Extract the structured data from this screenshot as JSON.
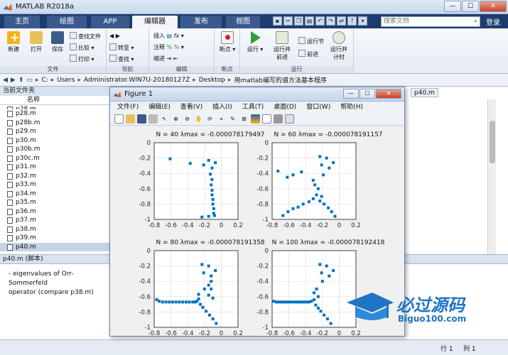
{
  "app": {
    "title": "MATLAB R2018a"
  },
  "window_buttons": {
    "minimize": "—",
    "maximize": "☐",
    "close": "✕"
  },
  "tabs": [
    {
      "label": "主页"
    },
    {
      "label": "绘图"
    },
    {
      "label": "APP"
    },
    {
      "label": "编辑器"
    },
    {
      "label": "发布"
    },
    {
      "label": "视图"
    }
  ],
  "search": {
    "placeholder": "搜索文档"
  },
  "login": "登录",
  "ribbon": {
    "file": {
      "new": "新建",
      "open": "打开",
      "save": "保存",
      "find_file": "查找文件",
      "compare": "比较",
      "print": "打印",
      "group": "文件"
    },
    "nav": {
      "goto": "转至",
      "find": "查找",
      "group": "导航"
    },
    "edit": {
      "insert": "插入",
      "comment": "注释",
      "indent": "缩进",
      "group": "编辑"
    },
    "breakpoints": {
      "label": "断点",
      "group": "断点"
    },
    "run": {
      "run": "运行",
      "run_advance": "运行并\n前进",
      "run_section": "运行节",
      "advance": "前进",
      "run_time": "运行并\n计时",
      "group": "运行"
    }
  },
  "address": [
    "C:",
    "Users",
    "Administrator.WIN7U-20180127Z",
    "Desktop",
    "用matlab编写的谱方法基本程序"
  ],
  "folder": {
    "title": "当前文件夹",
    "column": "名称",
    "files": [
      "p28.m",
      "p28b.m",
      "p29.m",
      "p30.m",
      "p30b.m",
      "p30c.m",
      "p31.m",
      "p32.m",
      "p33.m",
      "p34.m",
      "p35.m",
      "p36.m",
      "p37.m",
      "p38.m",
      "p39.m",
      "p40.m"
    ],
    "selected": "p40.m",
    "partial": "p28.m"
  },
  "editor_tab": "p40.m",
  "script_bar": "p40.m  (脚本)",
  "description": [
    "- eigenvalues of Orr-Sommerfeld",
    "operator (compare p38.m)"
  ],
  "status": {
    "row_label": "行",
    "row": "1",
    "col_label": "列",
    "col": "1"
  },
  "figure": {
    "title": "Figure 1",
    "menu": [
      "文件(F)",
      "编辑(E)",
      "查看(V)",
      "插入(I)",
      "工具(T)",
      "桌面(D)",
      "窗口(W)",
      "帮助(H)"
    ]
  },
  "watermark": {
    "cn": "必过源码",
    "url": "Biguo100.com"
  },
  "chart_data": [
    {
      "type": "scatter",
      "title": "N = 40   λmax = -0.000078179497",
      "xlim": [
        -0.8,
        0.2
      ],
      "ylim": [
        -1,
        0
      ],
      "xticks": [
        -0.8,
        -0.6,
        -0.4,
        -0.2,
        0,
        0.2
      ],
      "yticks": [
        0,
        -0.2,
        -0.4,
        -0.6,
        -0.8,
        -1
      ],
      "color": "#0072bd",
      "points": [
        [
          -0.61,
          -0.21
        ],
        [
          -0.37,
          -0.27
        ],
        [
          -0.15,
          -0.23
        ],
        [
          -0.07,
          -0.26
        ],
        [
          -0.21,
          -0.29
        ],
        [
          -0.11,
          -0.33
        ],
        [
          -0.13,
          -0.41
        ],
        [
          -0.11,
          -0.48
        ],
        [
          -0.12,
          -0.55
        ],
        [
          -0.11,
          -0.62
        ],
        [
          -0.11,
          -0.68
        ],
        [
          -0.1,
          -0.74
        ],
        [
          -0.1,
          -0.8
        ],
        [
          -0.09,
          -0.86
        ],
        [
          -0.09,
          -0.92
        ],
        [
          -0.08,
          -0.95
        ],
        [
          -0.15,
          -0.96
        ],
        [
          -0.23,
          -0.97
        ]
      ]
    },
    {
      "type": "scatter",
      "title": "N = 60   λmax = -0.000078191157",
      "xlim": [
        -0.8,
        0.2
      ],
      "ylim": [
        -1,
        0
      ],
      "xticks": [
        -0.8,
        -0.6,
        -0.4,
        -0.2,
        0,
        0.2
      ],
      "yticks": [
        0,
        -0.2,
        -0.4,
        -0.6,
        -0.8,
        -1
      ],
      "color": "#0072bd",
      "points": [
        [
          -0.23,
          -0.18
        ],
        [
          -0.15,
          -0.2
        ],
        [
          -0.07,
          -0.26
        ],
        [
          -0.21,
          -0.29
        ],
        [
          -0.12,
          -0.33
        ],
        [
          -0.45,
          -0.38
        ],
        [
          -0.55,
          -0.42
        ],
        [
          -0.62,
          -0.45
        ],
        [
          -0.73,
          -0.37
        ],
        [
          -0.19,
          -0.42
        ],
        [
          -0.31,
          -0.49
        ],
        [
          -0.29,
          -0.55
        ],
        [
          -0.25,
          -0.6
        ],
        [
          -0.27,
          -0.68
        ],
        [
          -0.31,
          -0.73
        ],
        [
          -0.36,
          -0.77
        ],
        [
          -0.43,
          -0.8
        ],
        [
          -0.49,
          -0.84
        ],
        [
          -0.55,
          -0.86
        ],
        [
          -0.61,
          -0.9
        ],
        [
          -0.67,
          -0.95
        ],
        [
          -0.23,
          -0.76
        ],
        [
          -0.18,
          -0.8
        ],
        [
          -0.13,
          -0.85
        ],
        [
          -0.09,
          -0.9
        ],
        [
          -0.05,
          -0.96
        ],
        [
          -0.21,
          -0.7
        ]
      ]
    },
    {
      "type": "scatter",
      "title": "N = 80   λmax = -0.000078191358",
      "xlim": [
        -0.8,
        0.2
      ],
      "ylim": [
        -1,
        0
      ],
      "xticks": [
        -0.8,
        -0.6,
        -0.4,
        -0.2,
        0,
        0.2
      ],
      "yticks": [
        0,
        -0.2,
        -0.4,
        -0.6,
        -0.8,
        -1
      ],
      "color": "#0072bd",
      "points": [
        [
          -0.23,
          -0.18
        ],
        [
          -0.15,
          -0.2
        ],
        [
          -0.07,
          -0.26
        ],
        [
          -0.21,
          -0.29
        ],
        [
          -0.12,
          -0.33
        ],
        [
          -0.15,
          -0.45
        ],
        [
          -0.2,
          -0.5
        ],
        [
          -0.27,
          -0.57
        ],
        [
          -0.77,
          -0.64
        ],
        [
          -0.74,
          -0.66
        ],
        [
          -0.7,
          -0.67
        ],
        [
          -0.66,
          -0.67
        ],
        [
          -0.62,
          -0.67
        ],
        [
          -0.58,
          -0.67
        ],
        [
          -0.54,
          -0.67
        ],
        [
          -0.5,
          -0.67
        ],
        [
          -0.46,
          -0.67
        ],
        [
          -0.42,
          -0.67
        ],
        [
          -0.38,
          -0.67
        ],
        [
          -0.34,
          -0.67
        ],
        [
          -0.31,
          -0.67
        ],
        [
          -0.29,
          -0.66
        ],
        [
          -0.27,
          -0.63
        ],
        [
          -0.25,
          -0.7
        ],
        [
          -0.22,
          -0.74
        ],
        [
          -0.18,
          -0.79
        ],
        [
          -0.14,
          -0.84
        ],
        [
          -0.1,
          -0.89
        ],
        [
          -0.06,
          -0.95
        ],
        [
          -0.15,
          -0.58
        ],
        [
          -0.12,
          -0.5
        ],
        [
          -0.1,
          -0.62
        ],
        [
          -0.12,
          -0.4
        ]
      ]
    },
    {
      "type": "scatter",
      "title": "N = 100   λmax = -0.000078192418",
      "xlim": [
        -0.8,
        0.2
      ],
      "ylim": [
        -1,
        0
      ],
      "xticks": [
        -0.8,
        -0.6,
        -0.4,
        -0.2,
        0,
        0.2
      ],
      "yticks": [
        0,
        -0.2,
        -0.4,
        -0.6,
        -0.8,
        -1
      ],
      "color": "#0072bd",
      "points": [
        [
          -0.23,
          -0.18
        ],
        [
          -0.15,
          -0.2
        ],
        [
          -0.07,
          -0.26
        ],
        [
          -0.21,
          -0.29
        ],
        [
          -0.12,
          -0.33
        ],
        [
          -0.2,
          -0.4
        ],
        [
          -0.27,
          -0.5
        ],
        [
          -0.3,
          -0.55
        ],
        [
          -0.25,
          -0.6
        ],
        [
          -0.78,
          -0.66
        ],
        [
          -0.75,
          -0.67
        ],
        [
          -0.72,
          -0.67
        ],
        [
          -0.69,
          -0.67
        ],
        [
          -0.66,
          -0.67
        ],
        [
          -0.63,
          -0.67
        ],
        [
          -0.6,
          -0.67
        ],
        [
          -0.57,
          -0.67
        ],
        [
          -0.54,
          -0.67
        ],
        [
          -0.51,
          -0.67
        ],
        [
          -0.48,
          -0.67
        ],
        [
          -0.45,
          -0.67
        ],
        [
          -0.42,
          -0.67
        ],
        [
          -0.39,
          -0.67
        ],
        [
          -0.36,
          -0.67
        ],
        [
          -0.33,
          -0.66
        ],
        [
          -0.3,
          -0.64
        ],
        [
          -0.28,
          -0.71
        ],
        [
          -0.25,
          -0.75
        ],
        [
          -0.22,
          -0.79
        ],
        [
          -0.18,
          -0.84
        ],
        [
          -0.14,
          -0.89
        ],
        [
          -0.1,
          -0.95
        ]
      ]
    }
  ]
}
